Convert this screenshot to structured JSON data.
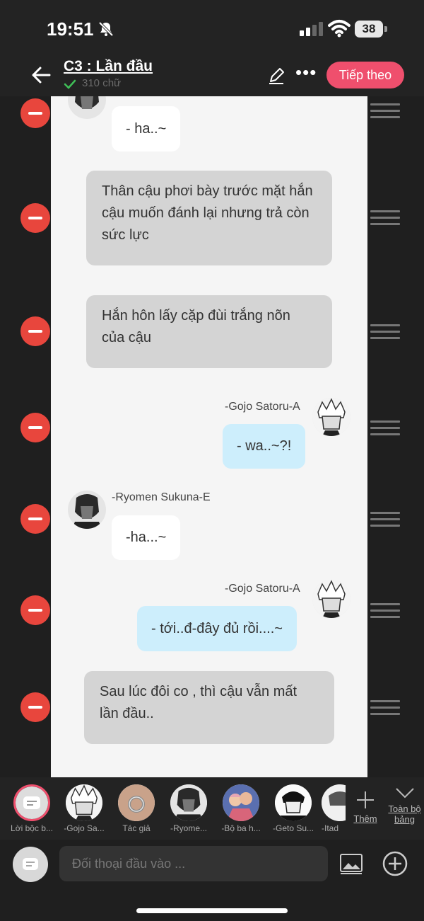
{
  "status_bar": {
    "time": "19:51",
    "battery": "38"
  },
  "header": {
    "title": "C3 : Lần đầu",
    "word_count": "310 chữ",
    "next_label": "Tiếp theo"
  },
  "messages": [
    {
      "type": "character",
      "side": "left",
      "text": "- ha..~"
    },
    {
      "type": "narration",
      "text": "Thân cậu phơi bày trước mặt hắn  cậu muốn đánh lại nhưng trả còn sức lực"
    },
    {
      "type": "narration",
      "text": "Hắn hôn lấy cặp đùi trắng nõn của cậu"
    },
    {
      "type": "character",
      "side": "right",
      "speaker": "-Gojo Satoru-A",
      "text": "- wa..~?!"
    },
    {
      "type": "character",
      "side": "left",
      "speaker": "-Ryomen Sukuna-E",
      "text": "-ha...~"
    },
    {
      "type": "character",
      "side": "right",
      "speaker": "-Gojo Satoru-A",
      "text": "- tới..đ-đây đủ rồi....~"
    },
    {
      "type": "narration",
      "text": "Sau lúc đôi co , thì cậu vẫn mất lần đầu.."
    }
  ],
  "characters": [
    {
      "label": "Lời bộc b..."
    },
    {
      "label": "-Gojo Sa..."
    },
    {
      "label": "Tác giả"
    },
    {
      "label": "-Ryome..."
    },
    {
      "label": "-Bộ ba h..."
    },
    {
      "label": "-Geto Su..."
    },
    {
      "label": "-Itad"
    }
  ],
  "add_character_label": "Thêm",
  "all_characters_label": "Toàn bộ bảng",
  "input": {
    "placeholder": "Đối thoại đầu vào ..."
  },
  "colors": {
    "accent": "#ef4f6d",
    "delete": "#e8463d",
    "right_bubble": "#cdeefc",
    "narration_bubble": "#d4d4d4"
  }
}
